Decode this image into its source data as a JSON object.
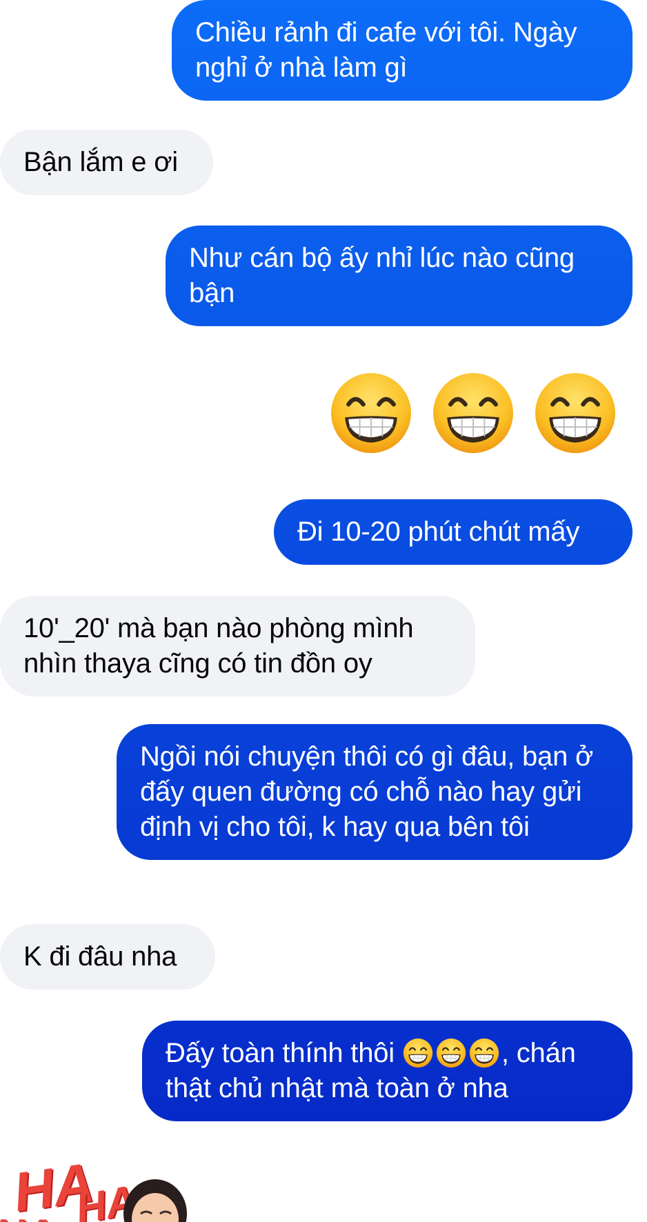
{
  "messages": {
    "m1": "Chiều rảnh đi cafe với tôi. Ngày nghỉ ở nhà làm gì",
    "m2": "Bận lắm e ơi",
    "m3": "Như cán bộ ấy nhỉ lúc nào cũng bận",
    "m5": "Đi 10-20 phút chút mấy",
    "m6": "10'_20' mà bạn nào phòng mình nhìn thaya cĩng có tin đồn oy",
    "m7": "Ngồi nói chuyện thôi có gì đâu, bạn ở đấy quen đường có chỗ nào hay gửi định vị cho tôi, k hay qua bên tôi",
    "m8": "K đi đâu nha",
    "m9_before": "Đấy toàn thính thôi ",
    "m9_after": ", chán thật chủ nhật mà toàn ở nha"
  },
  "emoji": {
    "name": "grinning-face-with-smiling-eyes",
    "count_big": 3,
    "count_inline": 3
  },
  "sticker": {
    "text_large": "HA",
    "text_small": "HA",
    "text_bottom": "HA"
  },
  "colors": {
    "incoming_bubble": "#f0f2f5",
    "outgoing_gradient_top": "#0c6cf7",
    "outgoing_gradient_bottom": "#0624c4",
    "emoji_yellow": "#fbbf24",
    "sticker_red": "#e9433a"
  }
}
